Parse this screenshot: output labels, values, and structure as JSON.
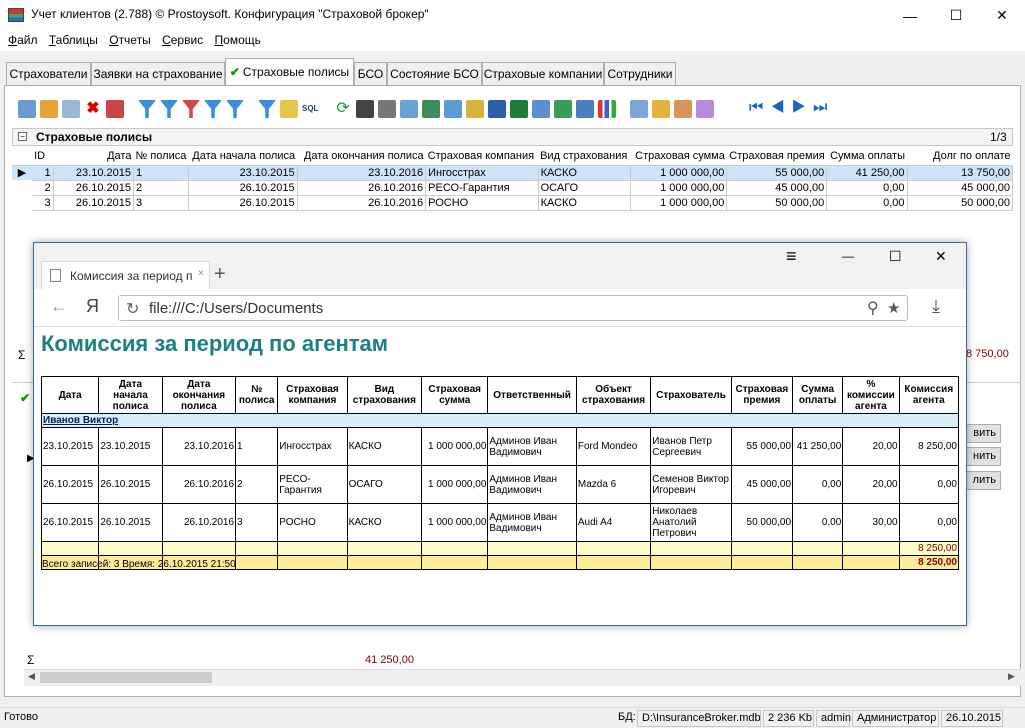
{
  "window": {
    "title": "Учет клиентов (2.788) © Prostoysoft. Конфигурация \"Страховой брокер\"",
    "minimize": "—",
    "maximize": "☐",
    "close": "✕"
  },
  "menu": [
    "Файл",
    "Таблицы",
    "Отчеты",
    "Сервис",
    "Помощь"
  ],
  "tabs": [
    "Страхователи",
    "Заявки на страхование",
    "Страховые полисы",
    "БСО",
    "Состояние БСО",
    "Страховые компании",
    "Сотрудники"
  ],
  "grid": {
    "title": "Страховые полисы",
    "count": "1/3",
    "columns": [
      "ID",
      "Дата",
      "№ полиса",
      "Дата начала полиса",
      "Дата окончания полиса",
      "Страховая компания",
      "Вид страхования",
      "Страховая сумма",
      "Страховая премия",
      "Сумма оплаты",
      "Долг по оплате"
    ],
    "rows": [
      [
        "1",
        "23.10.2015",
        "1",
        "23.10.2015",
        "23.10.2016",
        "Ингосстрах",
        "КАСКО",
        "1 000 000,00",
        "55 000,00",
        "41 250,00",
        "13 750,00"
      ],
      [
        "2",
        "26.10.2015",
        "2",
        "26.10.2015",
        "26.10.2016",
        "РЕСО-Гарантия",
        "ОСАГО",
        "1 000 000,00",
        "45 000,00",
        "0,00",
        "45 000,00"
      ],
      [
        "3",
        "26.10.2015",
        "3",
        "26.10.2015",
        "26.10.2016",
        "РОСНО",
        "КАСКО",
        "1 000 000,00",
        "50 000,00",
        "0,00",
        "50 000,00"
      ]
    ],
    "sigma": "Σ",
    "sum_debt_partial": "8 750,00"
  },
  "bottom": {
    "sigma": "Σ",
    "sum": "41 250,00",
    "buttons": [
      "вить",
      "нить",
      "лить"
    ]
  },
  "status": {
    "ready": "Готово",
    "db_label": "БД:",
    "db_path": "D:\\InsuranceBroker.mdb",
    "size": "2 236 Kb",
    "user": "admin",
    "role": "Администратор",
    "date": "26.10.2015"
  },
  "browser": {
    "tab_title": "Комиссия за период п",
    "new_tab": "+",
    "menu_icon": "≡",
    "minimize": "—",
    "maximize": "☐",
    "close": "✕",
    "back": "←",
    "ya": "Я",
    "url": "file:///C:/Users/Documents",
    "search_icon": "⚲",
    "star_icon": "★",
    "download_icon": "⤓"
  },
  "report": {
    "title": "Комиссия за период по агентам",
    "columns": [
      "Дата",
      "Дата начала полиса",
      "Дата окончания полиса",
      "№ полиса",
      "Страховая компания",
      "Вид страхования",
      "Страховая сумма",
      "Ответственный",
      "Объект страхования",
      "Страхователь",
      "Страховая премия",
      "Сумма оплаты",
      "% комиссии агента",
      "Комиссия агента"
    ],
    "group": "Иванов Виктор",
    "rows": [
      [
        "23.10.2015",
        "23.10.2015",
        "23.10.2016",
        "1",
        "Ингосстрах",
        "КАСКО",
        "1 000 000,00",
        "Админов Иван Вадимович",
        "Ford Mondeo",
        "Иванов Петр Сергеевич",
        "55 000,00",
        "41 250,00",
        "20,00",
        "8 250,00"
      ],
      [
        "26.10.2015",
        "26.10.2015",
        "26.10.2016",
        "2",
        "РЕСО-Гарантия",
        "ОСАГО",
        "1 000 000,00",
        "Админов Иван Вадимович",
        "Mazda 6",
        "Семенов Виктор Игоревич",
        "45 000,00",
        "0,00",
        "20,00",
        "0,00"
      ],
      [
        "26.10.2015",
        "26.10.2015",
        "26.10.2016",
        "3",
        "РОСНО",
        "КАСКО",
        "1 000 000,00",
        "Админов Иван Вадимович",
        "Audi A4",
        "Николаев Анатолий Петрович",
        "50 000,00",
        "0,00",
        "30,00",
        "0,00"
      ]
    ],
    "group_total": "8 250,00",
    "grand_total": "8 250,00",
    "footer": "Всего записей: 3     Время: 26.10.2015 21:50"
  },
  "colors": {
    "report_title": "#1e8080",
    "selected_row": "#cde4fb",
    "totals": "#800000"
  }
}
